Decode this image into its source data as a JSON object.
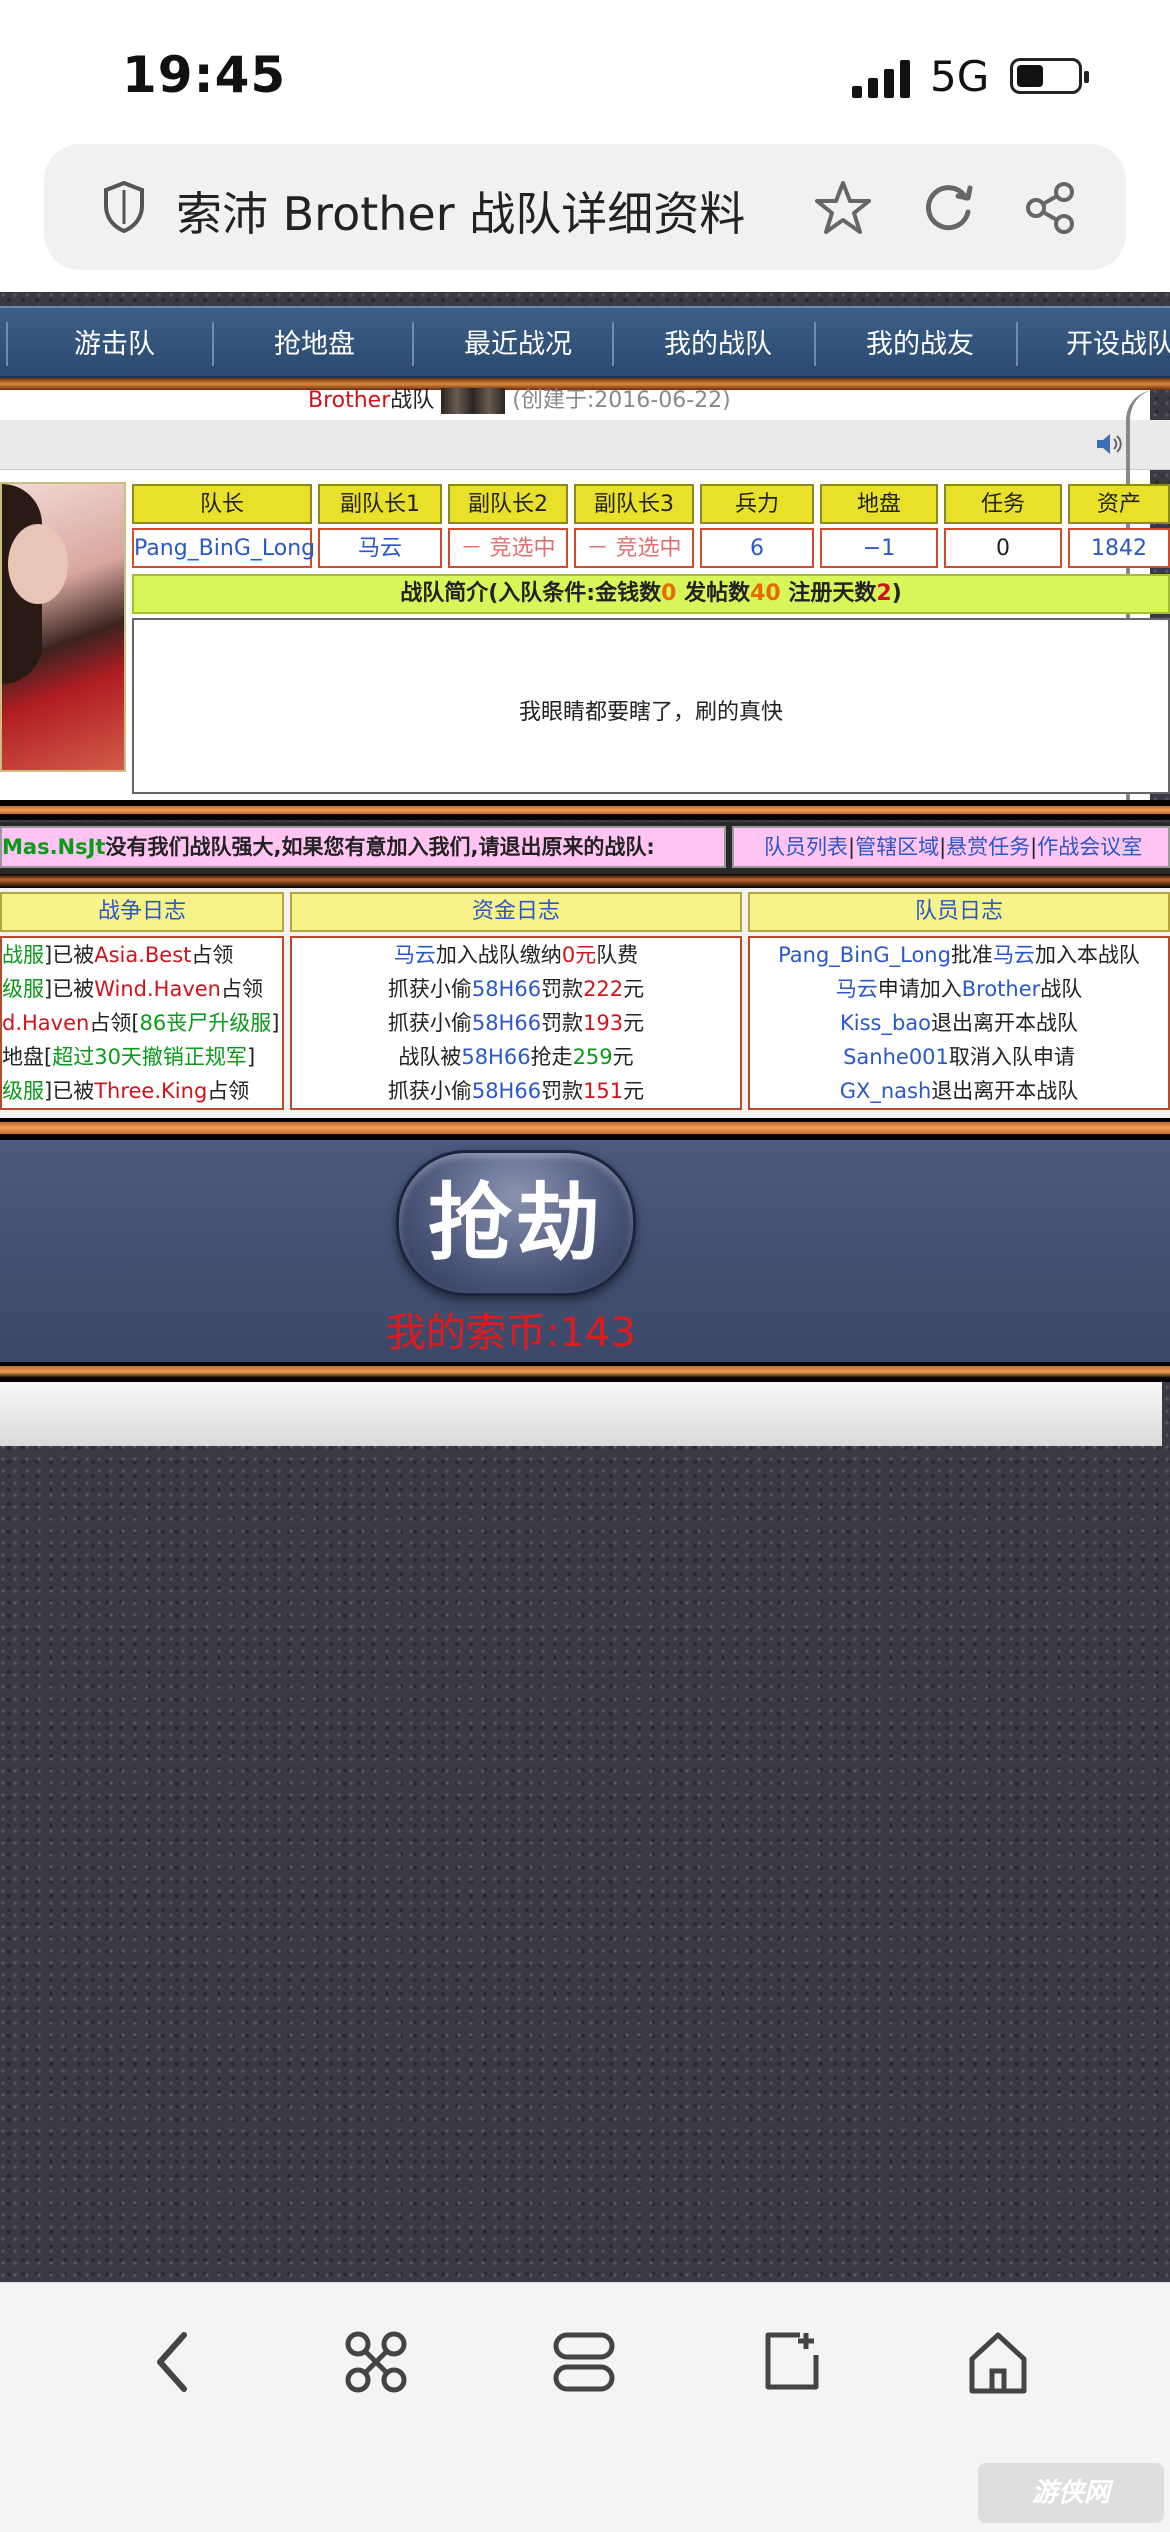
{
  "status_bar": {
    "time": "19:45",
    "network": "5G"
  },
  "browser": {
    "title": "索沛 Brother 战队详细资料"
  },
  "nav": {
    "items": [
      "游击队",
      "抢地盘",
      "最近战况",
      "我的战队",
      "我的战友",
      "开设战队"
    ]
  },
  "team_header": {
    "name": "Brother",
    "suffix": "战队",
    "created": "(创建于:2016-06-22)"
  },
  "roster": {
    "headers": [
      "队长",
      "副队长1",
      "副队长2",
      "副队长3",
      "兵力",
      "地盘",
      "任务",
      "资产"
    ],
    "values": [
      "Pang_BinG_Long",
      "马云",
      "－ 竞选中 －",
      "－ 竞选中 －",
      "6",
      "−1",
      "0",
      "1842"
    ]
  },
  "intro": {
    "label": "战队简介",
    "cond_open": "(入队条件:金钱数",
    "money": "0",
    "posts_label": " 发帖数",
    "posts": "40",
    "days_label": " 注册天数",
    "days": "2",
    "cond_close": ")",
    "text": "我眼睛都要瞎了，刷的真快"
  },
  "recruit": {
    "name": "Mas.NsJt",
    "text": "没有我们战队强大,如果您有意加入我们,请退出原来的战队:",
    "links": [
      "队员列表",
      "管辖区域",
      "悬赏任务",
      "作战会议室"
    ]
  },
  "logs": {
    "war": {
      "title": "战争日志",
      "lines": [
        {
          "a": "战服",
          "b": "]已被",
          "c": "Asia.Best",
          "d": "占领"
        },
        {
          "a": "级服",
          "b": "]已被",
          "c": "Wind.Haven",
          "d": "占领"
        },
        {
          "a": "d.Haven",
          "b": "占领[",
          "c": "86丧尸升级服",
          "d": "]"
        },
        {
          "a": "",
          "b": "地盘[",
          "c": "超过30天撤销正规军",
          "d": "]"
        },
        {
          "a": "级服",
          "b": "]已被",
          "c": "Three.King",
          "d": "占领"
        }
      ]
    },
    "money": {
      "title": "资金日志",
      "lines": [
        {
          "a": "马云",
          "b": "加入战队缴纳",
          "c": "0元",
          "d": "队费"
        },
        {
          "a": "抓获小偷",
          "b": "58H66",
          "c": "罚款",
          "d": "222",
          "e": "元"
        },
        {
          "a": "抓获小偷",
          "b": "58H66",
          "c": "罚款",
          "d": "193",
          "e": "元"
        },
        {
          "a": "战队被",
          "b": "58H66",
          "c": "抢走",
          "d": "259",
          "e": "元"
        },
        {
          "a": "抓获小偷",
          "b": "58H66",
          "c": "罚款",
          "d": "151",
          "e": "元"
        }
      ]
    },
    "members": {
      "title": "队员日志",
      "lines": [
        {
          "a": "Pang_BinG_Long",
          "b": "批准",
          "c": "马云",
          "d": "加入本战队"
        },
        {
          "a": "马云",
          "b": "申请加入",
          "c": "Brother",
          "d": "战队"
        },
        {
          "a": "Kiss_bao",
          "b": "退出离开本战队",
          "c": "",
          "d": ""
        },
        {
          "a": "Sanhe001",
          "b": "取消入队申请",
          "c": "",
          "d": ""
        },
        {
          "a": "GX_nash",
          "b": "退出离开本战队",
          "c": "",
          "d": ""
        }
      ]
    }
  },
  "rob": {
    "button": "抢劫",
    "coins": "我的索币:143"
  },
  "watermark": "游侠网"
}
